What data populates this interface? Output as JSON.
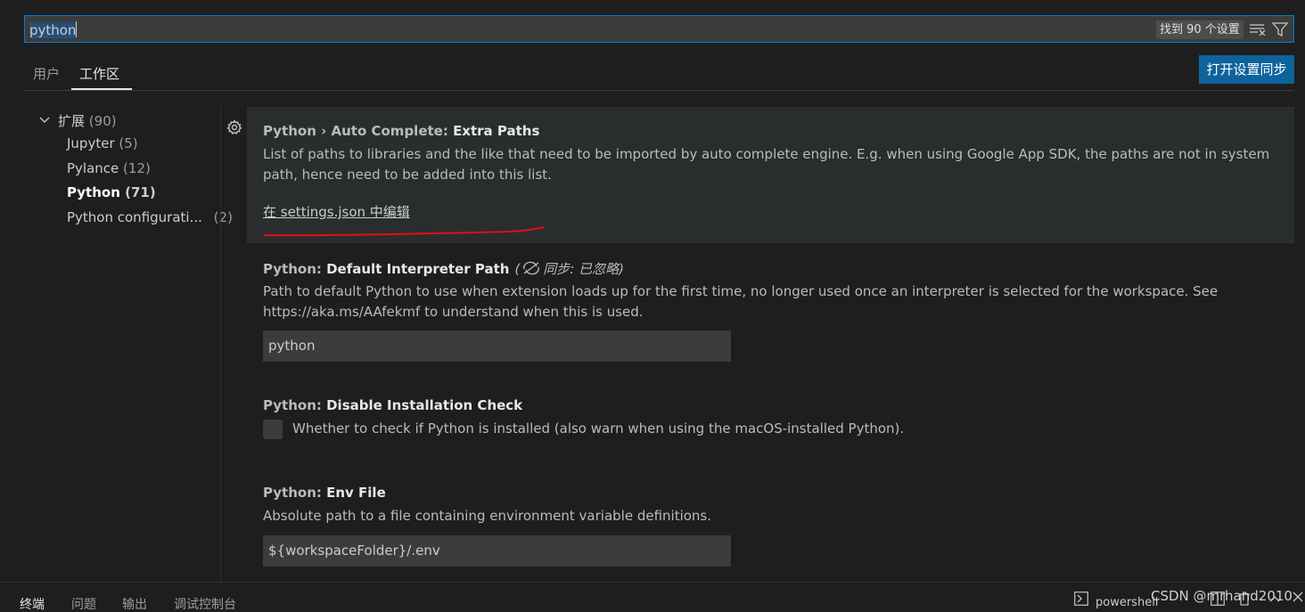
{
  "search": {
    "value": "python",
    "result_count": "找到 90 个设置"
  },
  "tabs": [
    {
      "label": "用户"
    },
    {
      "label": "工作区"
    }
  ],
  "sync_button": "打开设置同步",
  "toc": {
    "root_label": "扩展",
    "root_count": "(90)",
    "items": [
      {
        "label": "Jupyter",
        "count": "(5)"
      },
      {
        "label": "Pylance",
        "count": "(12)"
      },
      {
        "label": "Python",
        "count": "(71)"
      },
      {
        "label": "Python configurati...",
        "count": "(2)"
      }
    ]
  },
  "settings": [
    {
      "category": "Python › Auto Complete: ",
      "name": "Extra Paths",
      "description": "List of paths to libraries and the like that need to be imported by auto complete engine. E.g. when using Google App SDK, the paths are not in system path, hence need to be added into this list.",
      "link": "在 settings.json 中编辑"
    },
    {
      "category": "Python: ",
      "name": "Default Interpreter Path",
      "sync_note": "同步: 已忽略)",
      "sync_note_prefix": "(",
      "description": "Path to default Python to use when extension loads up for the first time, no longer used once an interpreter is selected for the workspace. See https://aka.ms/AAfekmf to understand when this is used.",
      "value": "python"
    },
    {
      "category": "Python: ",
      "name": "Disable Installation Check",
      "description": "Whether to check if Python is installed (also warn when using the macOS-installed Python).",
      "checked": false
    },
    {
      "category": "Python: ",
      "name": "Env File",
      "description": "Absolute path to a file containing environment variable definitions.",
      "value": "${workspaceFolder}/.env"
    }
  ],
  "panel": {
    "tabs": [
      "终端",
      "问题",
      "输出",
      "调试控制台"
    ],
    "terminal_name": "powershell"
  },
  "watermark": "CSDN @mrhand2010",
  "colors": {
    "accent": "#0e639c",
    "focus_border": "#007fd4",
    "annotation_red": "#e01010"
  }
}
